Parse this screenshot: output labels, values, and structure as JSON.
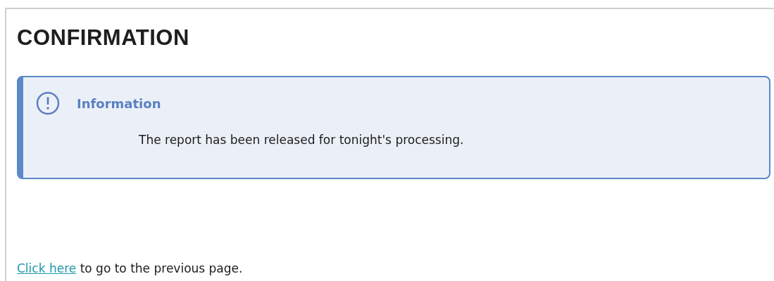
{
  "heading": "CONFIRMATION",
  "alert": {
    "title": "Information",
    "message": "The report has been released for tonight's processing."
  },
  "footer": {
    "link": "Click here",
    "text": " to go to the previous page."
  }
}
